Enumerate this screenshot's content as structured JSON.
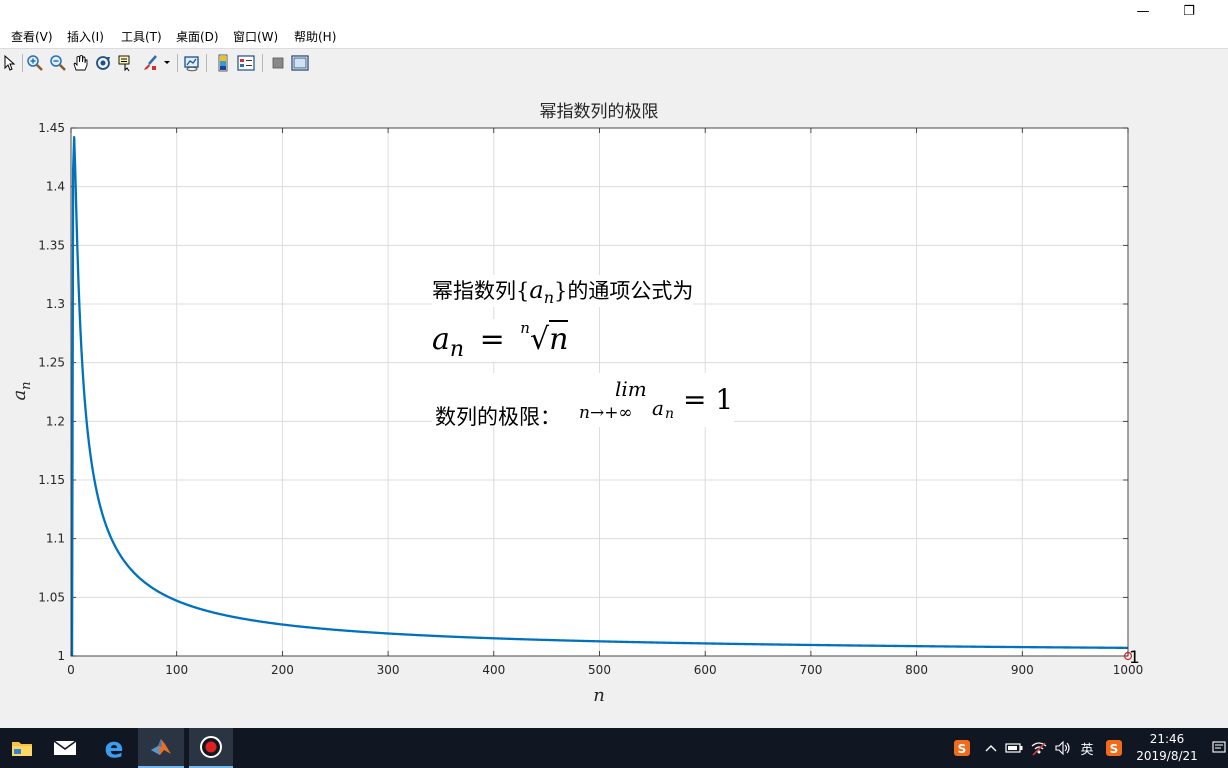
{
  "window": {
    "minimize_glyph": "—",
    "restore_glyph": "❐"
  },
  "menu": [
    "查看(V)",
    "插入(I)",
    "工具(T)",
    "桌面(D)",
    "窗口(W)",
    "帮助(H)"
  ],
  "toolbar": {
    "icons": [
      "pointer-icon",
      "zoom-in-icon",
      "zoom-out-icon",
      "pan-hand-icon",
      "rotate-3d-icon",
      "data-cursor-icon",
      "brush-icon",
      "link-plot-icon",
      "colorbar-icon",
      "legend-icon",
      "hide-plot-tools-icon",
      "show-plot-tools-icon"
    ]
  },
  "annotation": {
    "line1_prefix": "幂指数列{",
    "line1_var": "a",
    "line1_sub": "n",
    "line1_suffix": "}的通项公式为",
    "line2_var": "a",
    "line2_sub": "n",
    "line2_eq": "=",
    "line2_index": "n",
    "line2_radicand": "n",
    "line3_prefix": "数列的极限：",
    "line3_lim": "lim",
    "line3_under": "n→+∞",
    "line3_var": "a",
    "line3_sub": "n",
    "line3_rhs": "= 1"
  },
  "chart_data": {
    "type": "line",
    "title": "幂指数列的极限",
    "xlabel": "n",
    "ylabel": "a_n",
    "ylabel_base": "a",
    "ylabel_sub": "n",
    "xlim": [
      0,
      1000
    ],
    "ylim": [
      1,
      1.45
    ],
    "xticks": [
      0,
      100,
      200,
      300,
      400,
      500,
      600,
      700,
      800,
      900,
      1000
    ],
    "yticks": [
      1,
      1.05,
      1.1,
      1.15,
      1.2,
      1.25,
      1.3,
      1.35,
      1.4,
      1.45
    ],
    "xtick_labels": [
      "0",
      "100",
      "200",
      "300",
      "400",
      "500",
      "600",
      "700",
      "800",
      "900",
      "1000"
    ],
    "ytick_labels": [
      "1",
      "1.05",
      "1.1",
      "1.15",
      "1.2",
      "1.25",
      "1.3",
      "1.35",
      "1.4",
      "1.45"
    ],
    "grid": true,
    "series": [
      {
        "color": "#0072bd",
        "formula": "n^(1/n)",
        "x": [
          1,
          2,
          3,
          4,
          5,
          6,
          8,
          10,
          15,
          20,
          30,
          40,
          50,
          75,
          100,
          150,
          200,
          300,
          400,
          500,
          600,
          700,
          800,
          900,
          1000
        ],
        "y": [
          1.0,
          1.4142,
          1.4422,
          1.4142,
          1.3797,
          1.348,
          1.2968,
          1.2589,
          1.1981,
          1.1616,
          1.12,
          1.0966,
          1.0815,
          1.0593,
          1.0471,
          1.034,
          1.0269,
          1.0192,
          1.0151,
          1.0125,
          1.0107,
          1.0094,
          1.0084,
          1.0076,
          1.0069
        ]
      }
    ],
    "limit_marker": {
      "x": 1000,
      "y": 1,
      "label": "1",
      "color": "#d62728"
    }
  },
  "taskbar": {
    "time": "21:46",
    "date": "2019/8/21",
    "ime": "英"
  }
}
